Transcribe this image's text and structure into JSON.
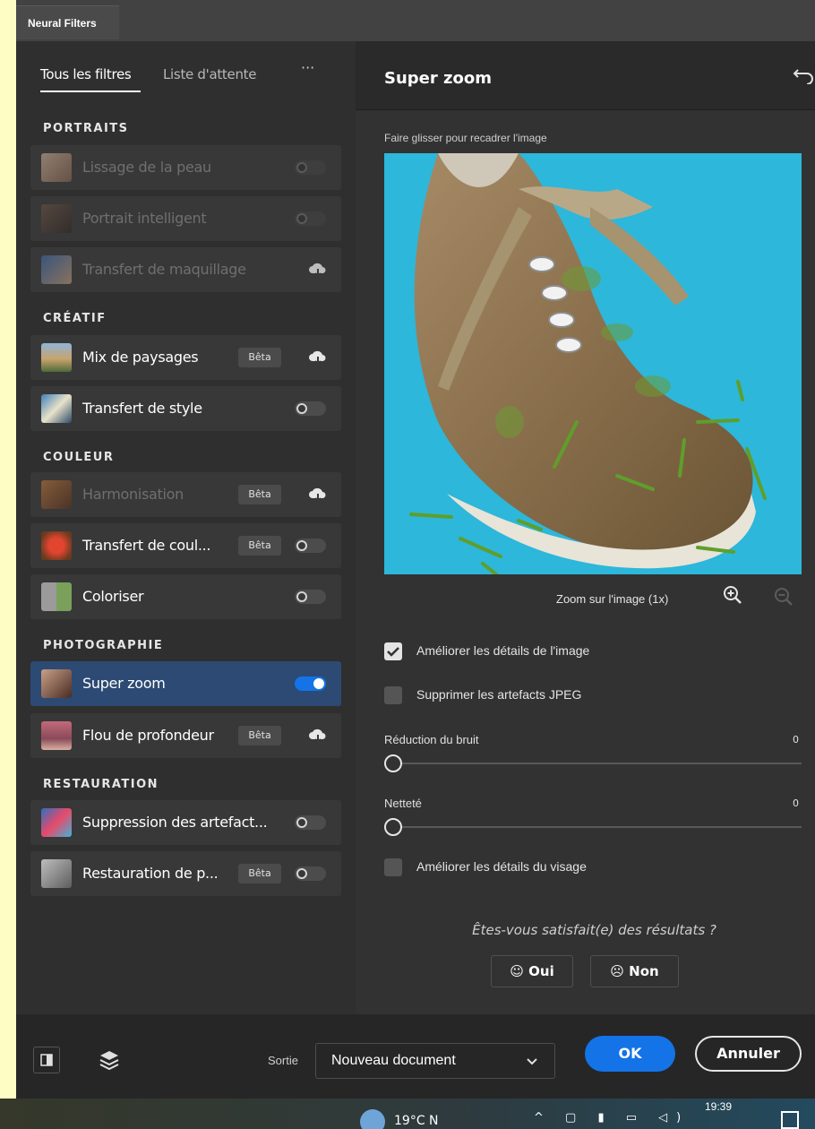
{
  "window": {
    "tab_title": "Neural Filters"
  },
  "left": {
    "tabs": [
      "Tous les filtres",
      "Liste d'attente"
    ],
    "more": "···",
    "categories": [
      {
        "label": "PORTRAITS"
      },
      {
        "label": "CRÉATIF"
      },
      {
        "label": "COULEUR"
      },
      {
        "label": "PHOTOGRAPHIE"
      },
      {
        "label": "RESTAURATION"
      }
    ],
    "filters": [
      {
        "name": "Lissage de la peau",
        "state": "toggle-off",
        "disabled": true
      },
      {
        "name": "Portrait intelligent",
        "state": "toggle-off",
        "disabled": true
      },
      {
        "name": "Transfert de maquillage",
        "state": "cloud",
        "disabled": true
      },
      {
        "name": "Mix de paysages",
        "badge": "Bêta",
        "state": "cloud"
      },
      {
        "name": "Transfert de style",
        "state": "toggle-off"
      },
      {
        "name": "Harmonisation",
        "badge": "Bêta",
        "state": "cloud",
        "disabled": true
      },
      {
        "name": "Transfert de coul...",
        "badge": "Bêta",
        "state": "toggle-off"
      },
      {
        "name": "Coloriser",
        "state": "toggle-off"
      },
      {
        "name": "Super zoom",
        "state": "toggle-on",
        "active": true
      },
      {
        "name": "Flou de profondeur",
        "badge": "Bêta",
        "state": "cloud"
      },
      {
        "name": "Suppression des artefact...",
        "state": "toggle-off"
      },
      {
        "name": "Restauration de p...",
        "badge": "Bêta",
        "state": "toggle-off"
      }
    ]
  },
  "right": {
    "title": "Super zoom",
    "drag_hint": "Faire glisser pour recadrer l'image",
    "zoom_label": "Zoom sur l'image (1x)",
    "options": [
      {
        "label": "Améliorer les détails de l'image",
        "checked": true
      },
      {
        "label": "Supprimer les artefacts JPEG",
        "checked": false
      },
      {
        "label": "Améliorer les détails du visage",
        "checked": false
      }
    ],
    "sliders": [
      {
        "label": "Réduction du bruit",
        "value": "0"
      },
      {
        "label": "Netteté",
        "value": "0"
      }
    ],
    "feedback": {
      "question": "Êtes-vous satisfait(e) des résultats ?",
      "yes": "Oui",
      "no": "Non"
    }
  },
  "bottom": {
    "output_label": "Sortie",
    "output_value": "Nouveau document",
    "ok": "OK",
    "cancel": "Annuler"
  },
  "taskbar": {
    "weather": "19°C  N",
    "clock": "19:39"
  },
  "colors": {
    "accent": "#1473e6",
    "active_row": "#2c4a73",
    "image_bg": "#28b4d8"
  }
}
